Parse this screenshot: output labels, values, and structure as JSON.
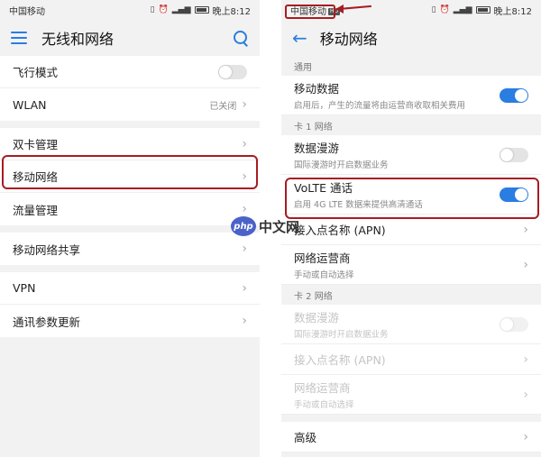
{
  "left": {
    "status": {
      "carrier": "中国移动",
      "time": "晚上8:12"
    },
    "title": "无线和网络",
    "groups": [
      [
        {
          "label": "飞行模式",
          "control": "toggle-off"
        },
        {
          "label": "WLAN",
          "value": "已关闭",
          "control": "chevron"
        }
      ],
      [
        {
          "label": "双卡管理",
          "control": "chevron"
        },
        {
          "label": "移动网络",
          "control": "chevron"
        },
        {
          "label": "流量管理",
          "control": "chevron"
        }
      ],
      [
        {
          "label": "移动网络共享",
          "control": "chevron"
        }
      ],
      [
        {
          "label": "VPN",
          "control": "chevron"
        },
        {
          "label": "通讯参数更新",
          "control": "chevron"
        }
      ]
    ]
  },
  "right": {
    "status": {
      "carrier": "中国移动",
      "carrier_badge": "HD",
      "time": "晚上8:12"
    },
    "title": "移动网络",
    "sections": [
      {
        "header": "通用",
        "rows": [
          {
            "title": "移动数据",
            "subtitle": "启用后，产生的流量将由运营商收取相关费用",
            "control": "toggle-on"
          }
        ]
      },
      {
        "header": "卡 1 网络",
        "rows": [
          {
            "title": "数据漫游",
            "subtitle": "国际漫游时开启数据业务",
            "control": "toggle-off"
          },
          {
            "title": "VoLTE 通话",
            "subtitle": "启用 4G LTE 数据来提供高清通话",
            "control": "toggle-on"
          },
          {
            "title": "接入点名称 (APN)",
            "subtitle": "",
            "control": "chevron"
          },
          {
            "title": "网络运营商",
            "subtitle": "手动或自动选择",
            "control": "chevron"
          }
        ]
      },
      {
        "header": "卡 2 网络",
        "rows": [
          {
            "title": "数据漫游",
            "subtitle": "国际漫游时开启数据业务",
            "control": "toggle-off",
            "disabled": true
          },
          {
            "title": "接入点名称 (APN)",
            "subtitle": "",
            "control": "chevron",
            "disabled": true
          },
          {
            "title": "网络运营商",
            "subtitle": "手动或自动选择",
            "control": "chevron",
            "disabled": true
          }
        ]
      },
      {
        "header": "",
        "rows": [
          {
            "title": "高级",
            "subtitle": "",
            "control": "chevron"
          }
        ]
      }
    ]
  },
  "watermark": {
    "logo": "php",
    "text": "中文网"
  },
  "colors": {
    "accent": "#2a7de1",
    "highlight": "#a71c23"
  },
  "icons": {
    "menu": "menu-icon",
    "search": "search-icon",
    "back": "back-arrow-icon",
    "chevron": "chevron-right-icon"
  }
}
